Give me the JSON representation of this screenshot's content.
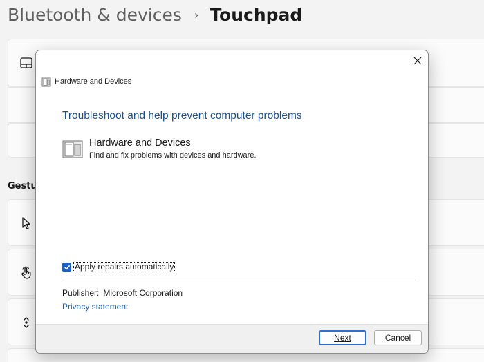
{
  "breadcrumb": {
    "parent": "Bluetooth & devices",
    "separator": "›",
    "current": "Touchpad"
  },
  "settings": {
    "section_title": "Gestur",
    "icons": [
      "touchpad-icon",
      "pointer-icon",
      "tap-gesture-icon",
      "scroll-vertical-icon"
    ]
  },
  "dialog": {
    "window_title": "Hardware and Devices",
    "heading": "Troubleshoot and help prevent computer problems",
    "item": {
      "title": "Hardware and Devices",
      "description": "Find and fix problems with devices and hardware."
    },
    "checkbox": {
      "label": "Apply repairs automatically",
      "checked": true
    },
    "publisher_label": "Publisher:",
    "publisher_value": "Microsoft Corporation",
    "privacy_link": "Privacy statement",
    "buttons": {
      "next": "Next",
      "cancel": "Cancel"
    }
  },
  "colors": {
    "heading_blue": "#1b4f92",
    "link_blue": "#1b5ea8",
    "checkbox_blue": "#1f5fbf"
  }
}
